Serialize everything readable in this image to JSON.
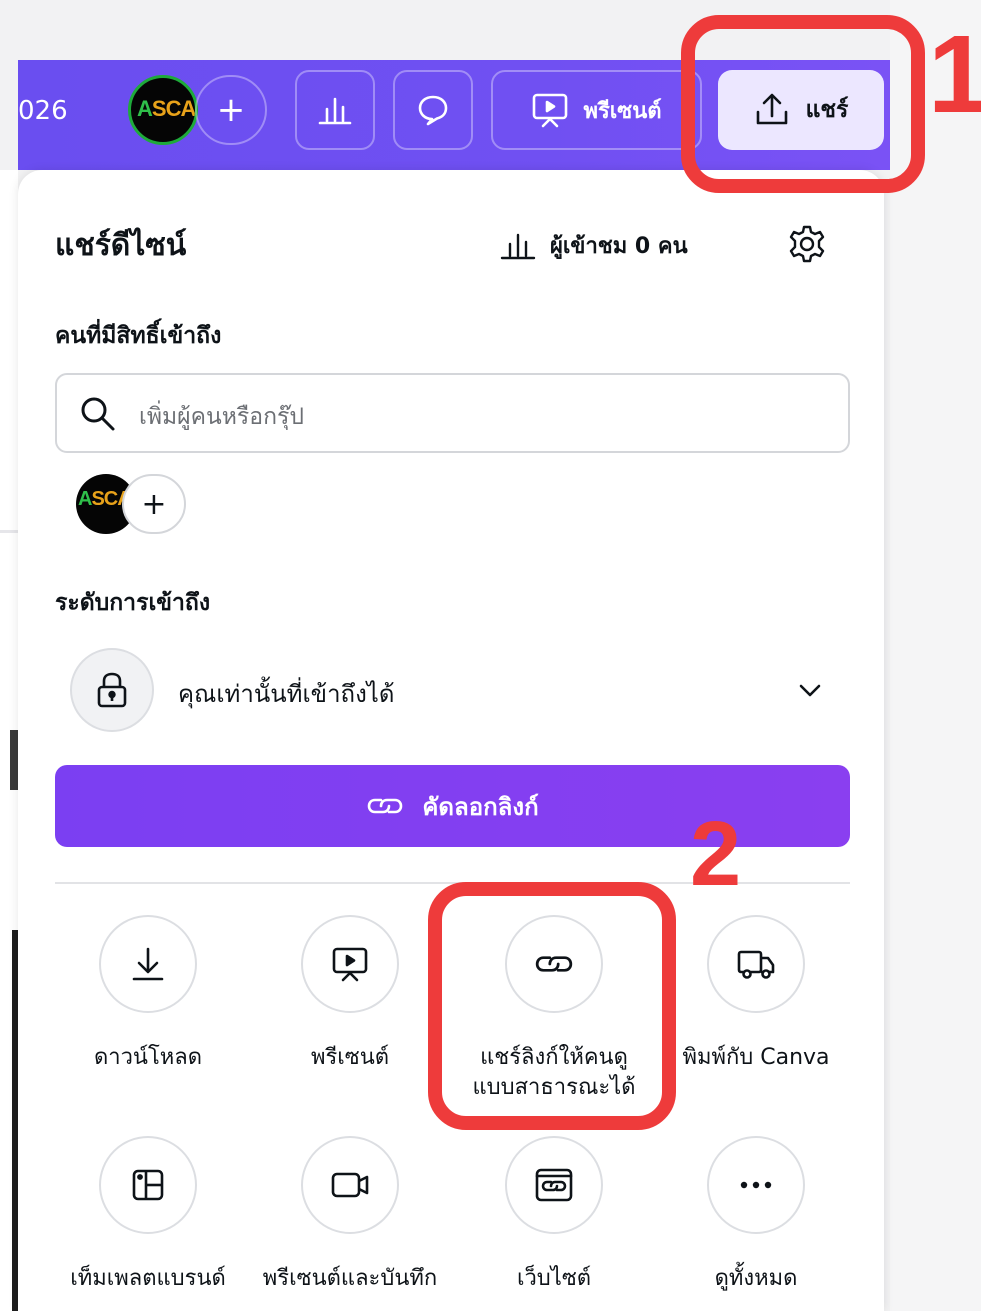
{
  "topbar": {
    "year_fragment": "026",
    "share_label": "แชร์",
    "present_label": "พรีเซนต์",
    "add_collaborator": "+"
  },
  "panel": {
    "title": "แชร์ดีไซน์",
    "viewers": "ผู้เข้าชม 0 คน",
    "access_heading": "คนที่มีสิทธิ์เข้าถึง",
    "search_placeholder": "เพิ่มผู้คนหรือกรุ๊ป",
    "add_person": "+",
    "access_level_heading": "ระดับการเข้าถึง",
    "access_level_value": "คุณเท่านั้นที่เข้าถึงได้",
    "copy_link": "คัดลอกลิงก์"
  },
  "options": [
    {
      "label": "ดาวน์โหลด",
      "icon": "download-icon"
    },
    {
      "label": "พรีเซนต์",
      "icon": "present-icon"
    },
    {
      "label": "แชร์ลิงก์ให้คนดูแบบสาธารณะได้",
      "label_line1": "แชร์ลิงก์ให้คนดู",
      "label_line2": "แบบสาธารณะได้",
      "icon": "link-icon"
    },
    {
      "label": "พิมพ์กับ Canva",
      "icon": "truck-icon"
    },
    {
      "label": "เท็มเพลตแบรนด์",
      "icon": "brand-template-icon"
    },
    {
      "label": "พรีเซนต์และบันทึก",
      "icon": "video-icon"
    },
    {
      "label": "เว็บไซต์",
      "icon": "website-icon"
    },
    {
      "label": "ดูทั้งหมด",
      "icon": "more-icon"
    }
  ],
  "annotations": {
    "step1": "1",
    "step2": "2"
  },
  "avatar_logo": {
    "a": "A",
    "rest": "SCAI"
  },
  "colors": {
    "topbar": "#6b4af0",
    "accent": "#7d2ae8",
    "annotation": "#ee3b3b",
    "share_bg": "#ece7ff"
  }
}
